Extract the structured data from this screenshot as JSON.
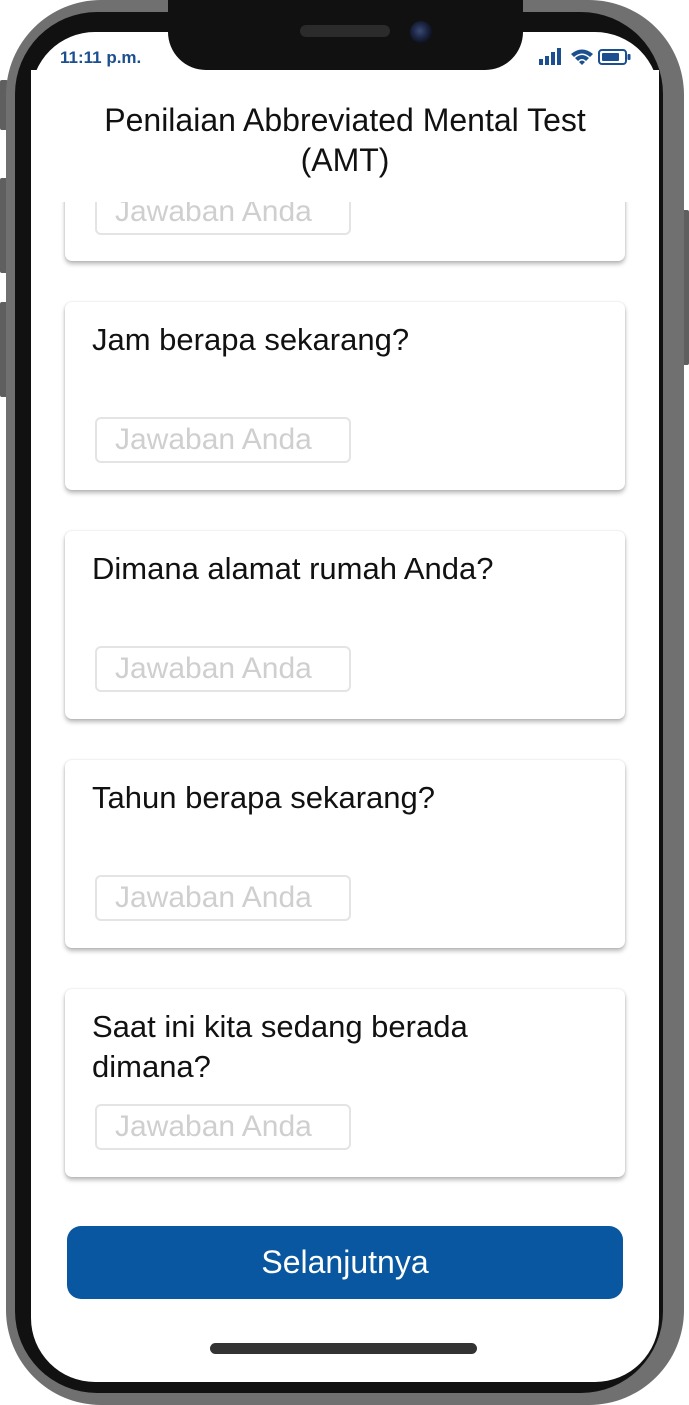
{
  "status_bar": {
    "time": "11:11 p.m.",
    "icons": [
      "signal-icon",
      "wifi-icon",
      "battery-icon"
    ],
    "icon_color": "#1b4f8f"
  },
  "header": {
    "title_line1": "Penilaian Abbreviated Mental Test",
    "title_line2": "(AMT)"
  },
  "partial_card": {
    "answer_placeholder": "Jawaban Anda"
  },
  "questions": [
    {
      "label": "Jam berapa sekarang?",
      "placeholder": "Jawaban Anda"
    },
    {
      "label": "Dimana alamat rumah Anda?",
      "placeholder": "Jawaban Anda"
    },
    {
      "label": "Tahun berapa sekarang?",
      "placeholder": "Jawaban Anda"
    },
    {
      "label_line1": "Saat ini kita sedang berada",
      "label_line2": "dimana?",
      "placeholder": "Jawaban Anda"
    }
  ],
  "next_button": {
    "label": "Selanjutnya",
    "color": "#0857a0"
  }
}
